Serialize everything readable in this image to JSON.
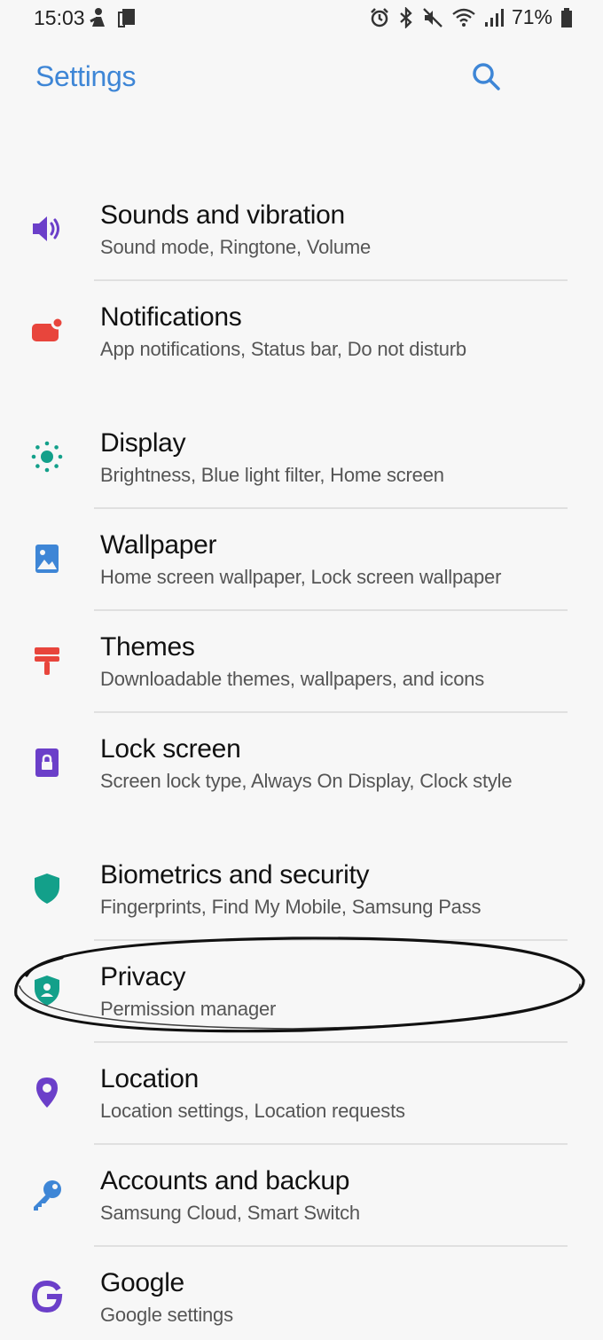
{
  "status_bar": {
    "time": "15:03",
    "battery_percent": "71%",
    "left_icons": [
      "person-notification-icon",
      "device-notification-icon"
    ],
    "right_icons": [
      "alarm-icon",
      "bluetooth-icon",
      "mute-icon",
      "wifi-icon",
      "signal-icon",
      "battery-icon"
    ]
  },
  "app_bar": {
    "title": "Settings",
    "search_icon": "search-icon"
  },
  "colors": {
    "accent_blue": "#3e86d6",
    "sounds_purple": "#6b3fc9",
    "notifications_red": "#e8453c",
    "display_teal": "#13a08a",
    "wallpaper_blue": "#3e86d6",
    "themes_red": "#e8453c",
    "lock_purple": "#6b3fc9",
    "biometrics_teal": "#13a08a",
    "privacy_teal": "#13a08a",
    "location_purple": "#6b3fc9",
    "accounts_blue": "#3e86d6",
    "google_purple": "#6b3fc9"
  },
  "settings": [
    {
      "title": "Sounds and vibration",
      "subtitle": "Sound mode, Ringtone, Volume",
      "icon": "volume-icon"
    },
    {
      "title": "Notifications",
      "subtitle": "App notifications, Status bar, Do not disturb",
      "icon": "notification-icon"
    },
    {
      "title": "Display",
      "subtitle": "Brightness, Blue light filter, Home screen",
      "icon": "brightness-icon"
    },
    {
      "title": "Wallpaper",
      "subtitle": "Home screen wallpaper, Lock screen wallpaper",
      "icon": "wallpaper-icon"
    },
    {
      "title": "Themes",
      "subtitle": "Downloadable themes, wallpapers, and icons",
      "icon": "paint-roller-icon"
    },
    {
      "title": "Lock screen",
      "subtitle": "Screen lock type, Always On Display, Clock style",
      "icon": "lock-icon"
    },
    {
      "title": "Biometrics and security",
      "subtitle": "Fingerprints, Find My Mobile, Samsung Pass",
      "icon": "shield-icon"
    },
    {
      "title": "Privacy",
      "subtitle": "Permission manager",
      "icon": "privacy-shield-icon"
    },
    {
      "title": "Location",
      "subtitle": "Location settings, Location requests",
      "icon": "location-pin-icon"
    },
    {
      "title": "Accounts and backup",
      "subtitle": "Samsung Cloud, Smart Switch",
      "icon": "key-icon"
    },
    {
      "title": "Google",
      "subtitle": "Google settings",
      "icon": "google-icon"
    }
  ]
}
